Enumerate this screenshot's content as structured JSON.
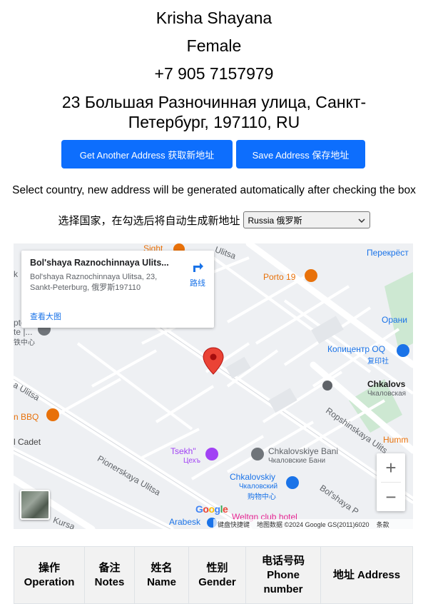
{
  "person": {
    "name": "Krisha Shayana",
    "gender": "Female",
    "phone": "+7 905 7157979",
    "address": "23 Большая Разночинная улица, Санкт-Петербург, 197110, RU"
  },
  "buttons": {
    "get_address": "Get Another Address 获取新地址",
    "save_address": "Save Address 保存地址"
  },
  "country_selector": {
    "hint_en": "Select country, new address will be generated automatically after checking the box",
    "hint_cn": "选择国家，在勾选后将自动生成新地址",
    "selected": "Russia 俄罗斯"
  },
  "map": {
    "info_card": {
      "title": "Bol'shaya Raznochinnaya Ulits...",
      "address": "Bol'shaya Raznochinnaya Ulitsa, 23, Sankt-Peterburg, 俄罗斯197110",
      "directions": "路线",
      "view_larger": "查看大图"
    },
    "labels": {
      "sight": "Sight",
      "ulitsa_top": "Ulitsa",
      "perekrest": "Перекрёст",
      "porto19": "Porto 19",
      "orani": "Орани",
      "kopicentr": "Копицентр OQ",
      "kopicentr_cn": "复印社",
      "chkalov": "Chkalovs",
      "chkalov_ru": "Чкаловская",
      "ulitsa_left": "a Ulitsa",
      "bbq": "n BBQ",
      "ropshinskaya": "Ropshinskaya Ulits",
      "cadet": "l Cadet",
      "humm": "Humm",
      "tsekh": "Tsekh\"",
      "tsekh_ru": "Цехъ",
      "chkalovskiye_bani": "Chkalovskiye Bani",
      "chkalovskiye_bani_ru": "Чкаловские Бани",
      "pionerskaya": "Pionerskaya Ulitsa",
      "chkalovskiy": "Chkalovskiy",
      "chkalovskiy_ru": "Чкаловский",
      "chkalovskiy_cn": "购物中心",
      "bolshaya": "Bol'shaya P",
      "kursa": "Kursa",
      "weltgen": "Weltgn club hotel",
      "arabesk": "Arabesk",
      "left_k": "k",
      "left_pte": "pte",
      "left_te": "te |...",
      "left_zhong": "铁中心"
    },
    "google": "Google",
    "attribution": {
      "shortcuts": "键盘快捷键",
      "data": "地图数据 ©2024 Google GS(2011)6020",
      "terms": "条款"
    },
    "zoom_in": "+",
    "zoom_out": "−"
  },
  "table": {
    "headers": [
      "操作 Operation",
      "备注 Notes",
      "姓名 Name",
      "性别 Gender",
      "电话号码 Phone number",
      "地址 Address"
    ]
  },
  "colors": {
    "primary": "#0d6efd",
    "map_bg": "#eef0f3",
    "pin": "#ea4335",
    "link": "#1a73e8"
  }
}
